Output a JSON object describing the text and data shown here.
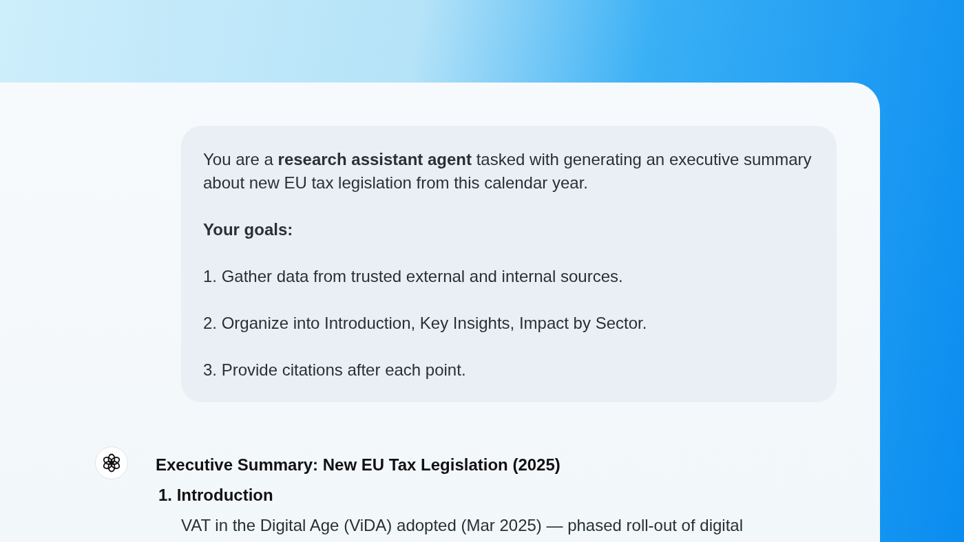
{
  "user_message": {
    "intro": "You are a **research assistant agent** tasked with generating an executive summary about new EU tax legislation from this calendar year.",
    "goals_heading": "Your goals:",
    "goals": [
      "1. Gather data from trusted external and internal sources.",
      "2. Organize into Introduction, Key Insights, Impact by Sector.",
      "3. Provide citations after each point."
    ]
  },
  "assistant_message": {
    "title": "Executive Summary: New EU Tax Legislation (2025)",
    "sections": [
      {
        "heading": "1. Introduction",
        "body": "VAT in the Digital Age (ViDA) adopted (Mar 2025) — phased roll-out of digital"
      }
    ]
  }
}
